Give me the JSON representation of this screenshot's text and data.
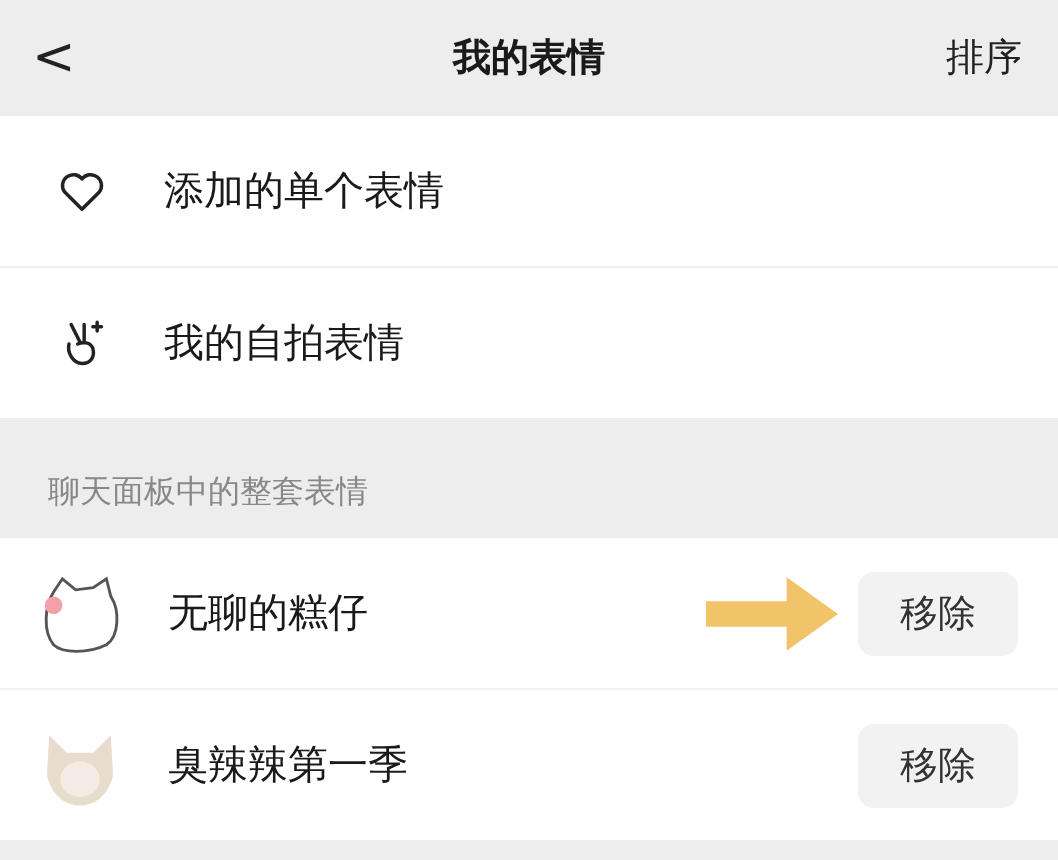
{
  "nav": {
    "back": "<",
    "title": "我的表情",
    "action": "排序"
  },
  "items": [
    {
      "kind": "heart",
      "label": "添加的单个表情"
    },
    {
      "kind": "hand",
      "label": "我的自拍表情"
    }
  ],
  "section": {
    "title": "聊天面板中的整套表情"
  },
  "packs": [
    {
      "kind": "cartoon",
      "name": "无聊的糕仔",
      "button": "移除",
      "pointed": true
    },
    {
      "kind": "picture",
      "name": "臭辣辣第一季",
      "button": "移除",
      "pointed": false
    }
  ]
}
